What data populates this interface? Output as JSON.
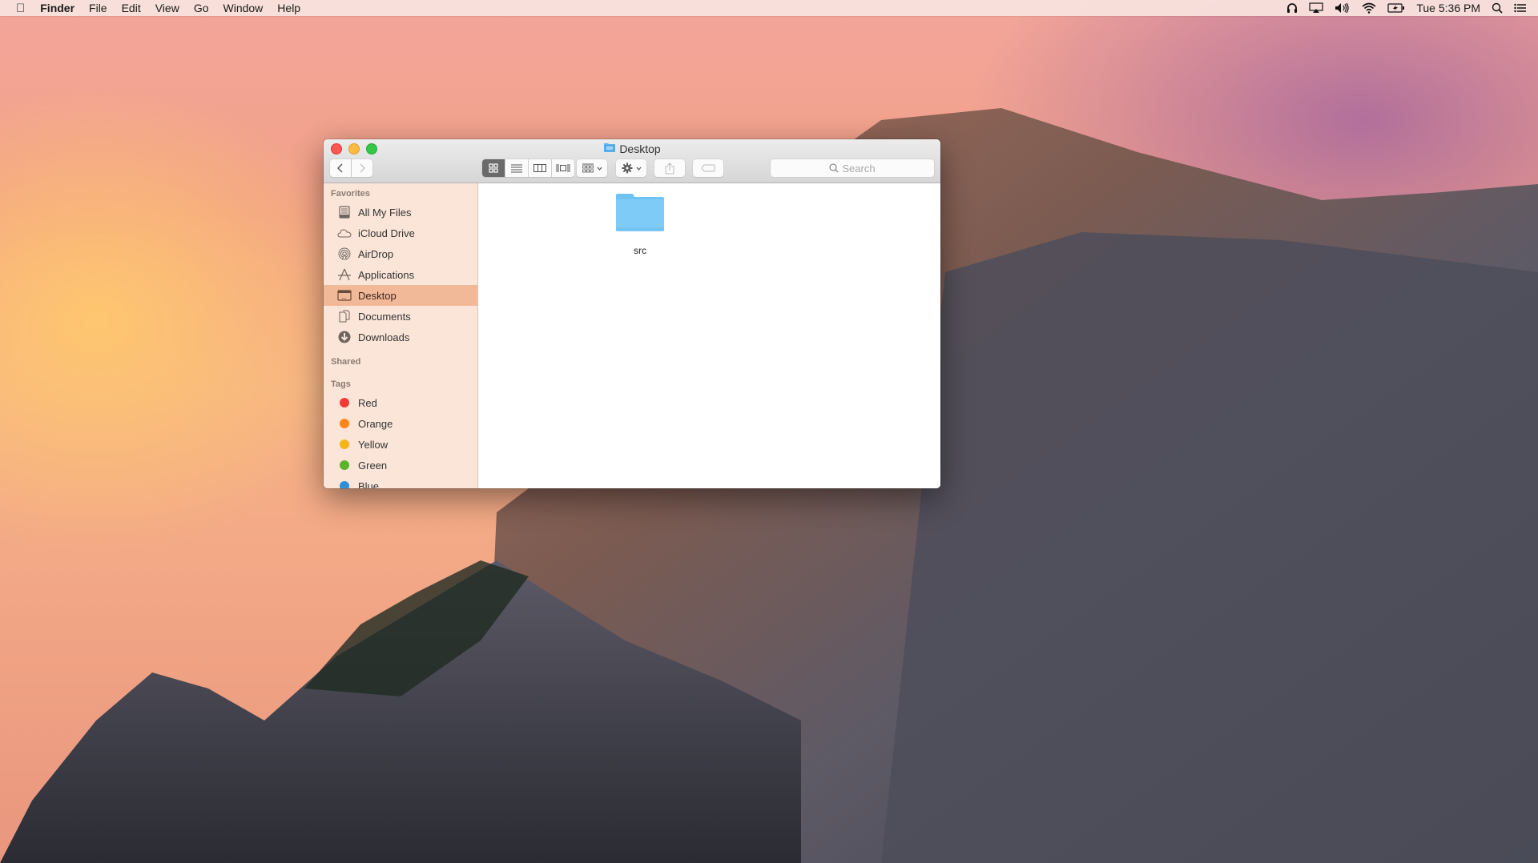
{
  "menubar": {
    "app_name": "Finder",
    "menus": [
      "File",
      "Edit",
      "View",
      "Go",
      "Window",
      "Help"
    ],
    "status_icons": [
      "headphones-icon",
      "airplay-icon",
      "volume-icon",
      "wifi-icon",
      "battery-charging-icon"
    ],
    "clock": "Tue 5:36 PM"
  },
  "window": {
    "title": "Desktop",
    "search_placeholder": "Search",
    "view_modes": [
      "icon",
      "list",
      "column",
      "cover-flow"
    ],
    "active_view": "icon"
  },
  "sidebar": {
    "favorites_label": "Favorites",
    "favorites": [
      {
        "label": "All My Files",
        "icon": "all-files-icon"
      },
      {
        "label": "iCloud Drive",
        "icon": "cloud-icon"
      },
      {
        "label": "AirDrop",
        "icon": "airdrop-icon"
      },
      {
        "label": "Applications",
        "icon": "applications-icon"
      },
      {
        "label": "Desktop",
        "icon": "desktop-icon",
        "selected": true
      },
      {
        "label": "Documents",
        "icon": "documents-icon"
      },
      {
        "label": "Downloads",
        "icon": "downloads-icon"
      }
    ],
    "shared_label": "Shared",
    "tags_label": "Tags",
    "tags": [
      {
        "label": "Red",
        "color": "#f43a36"
      },
      {
        "label": "Orange",
        "color": "#fb8518"
      },
      {
        "label": "Yellow",
        "color": "#f5b418"
      },
      {
        "label": "Green",
        "color": "#5ab42a"
      },
      {
        "label": "Blue",
        "color": "#2f8ed8"
      }
    ]
  },
  "content": {
    "files": [
      {
        "name": "src",
        "type": "folder"
      }
    ]
  }
}
